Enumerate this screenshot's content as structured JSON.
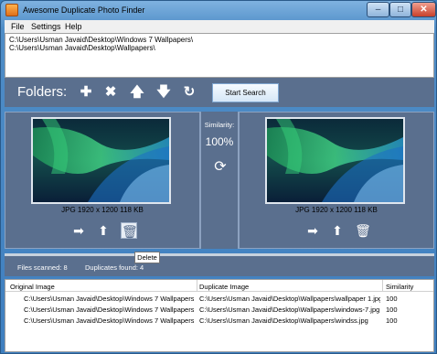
{
  "window": {
    "title": "Awesome Duplicate Photo Finder"
  },
  "menu": {
    "items": [
      "File",
      "Settings",
      "Help"
    ]
  },
  "paths": [
    "C:\\Users\\Usman Javaid\\Desktop\\Windows 7 Wallpapers\\",
    "C:\\Users\\Usman Javaid\\Desktop\\Wallpapers\\"
  ],
  "toolbar": {
    "folders_label": "Folders:",
    "start_label": "Start Search",
    "icons": [
      "plus-icon",
      "x-icon",
      "arrow-up-icon",
      "arrow-down-icon",
      "refresh-icon"
    ]
  },
  "compare": {
    "left_info": "JPG  1920 x 1200  118 KB",
    "right_info": "JPG  1920 x 1200  118 KB",
    "similarity_label": "Similarity:",
    "similarity_value": "100%"
  },
  "stats": {
    "files_scanned": "Files scanned: 8",
    "duplicates_found": "Duplicates found: 4"
  },
  "tooltip": "Delete",
  "results": {
    "headers": [
      "Original Image",
      "Duplicate Image",
      "Similarity"
    ],
    "rows": [
      [
        "C:\\Users\\Usman Javaid\\Desktop\\Windows 7 Wallpapers...",
        "C:\\Users\\Usman Javaid\\Desktop\\Wallpapers\\wallpaper 1.jpg",
        "100"
      ],
      [
        "C:\\Users\\Usman Javaid\\Desktop\\Windows 7 Wallpapers...",
        "C:\\Users\\Usman Javaid\\Desktop\\Wallpapers\\windows-7.jpg",
        "100"
      ],
      [
        "C:\\Users\\Usman Javaid\\Desktop\\Windows 7 Wallpapers...",
        "C:\\Users\\Usman Javaid\\Desktop\\Wallpapers\\windss.jpg",
        "100"
      ]
    ]
  },
  "colors": {
    "panel": "#5a6f8e",
    "titlebar": "#4f8dc7",
    "aurora_green": "#38d27a",
    "aurora_blue": "#2a7fd0"
  }
}
